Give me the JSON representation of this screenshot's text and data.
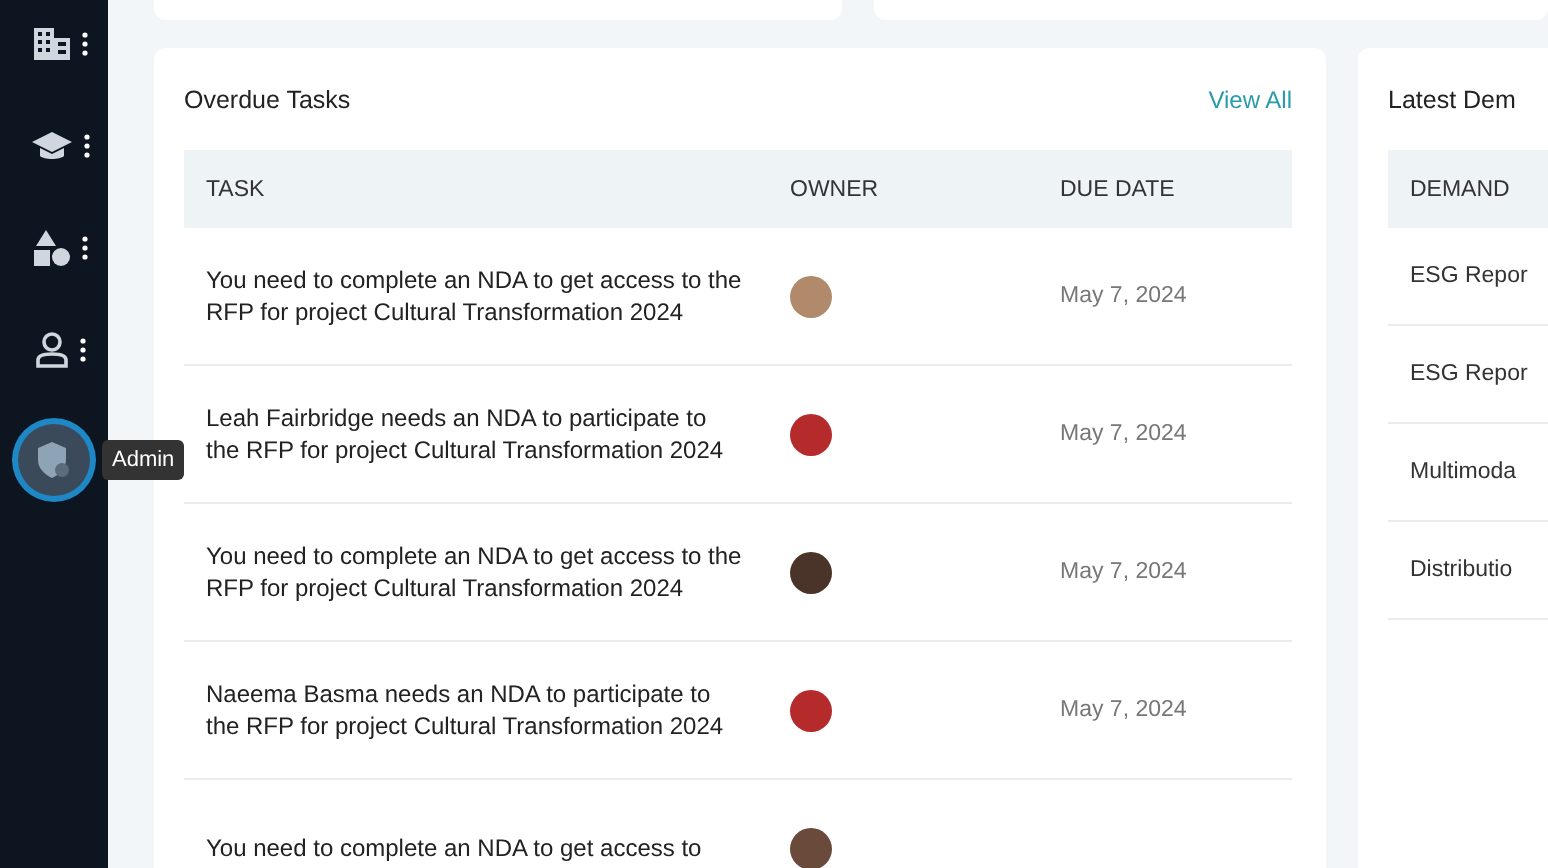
{
  "sidebar": {
    "items": [
      {
        "selected": false
      },
      {
        "selected": false
      },
      {
        "selected": false
      },
      {
        "selected": false
      },
      {
        "selected": true
      }
    ],
    "tooltip": "Admin"
  },
  "overdue_tasks": {
    "title": "Overdue Tasks",
    "link": "View All",
    "columns": [
      "TASK",
      "OWNER",
      "DUE DATE"
    ],
    "rows": [
      {
        "task": "You need to complete an NDA to get access to the RFP for project Cultural Transformation 2024",
        "due": "May 7, 2024"
      },
      {
        "task": "Leah Fairbridge needs an NDA to participate to the RFP for project Cultural Transformation 2024",
        "due": "May 7, 2024"
      },
      {
        "task": "You need to complete an NDA to get access to the RFP for project Cultural Transformation 2024",
        "due": "May 7, 2024"
      },
      {
        "task": "Naeema Basma needs an NDA to participate to the RFP for project Cultural Transformation 2024",
        "due": "May 7, 2024"
      },
      {
        "task": "You need to complete an NDA to get access to"
      }
    ]
  },
  "latest_demands": {
    "title": "Latest Dem",
    "columns": [
      "DEMAND"
    ],
    "rows": [
      "ESG Repor",
      "ESG Repor",
      "Multimoda",
      "Distributio"
    ]
  }
}
